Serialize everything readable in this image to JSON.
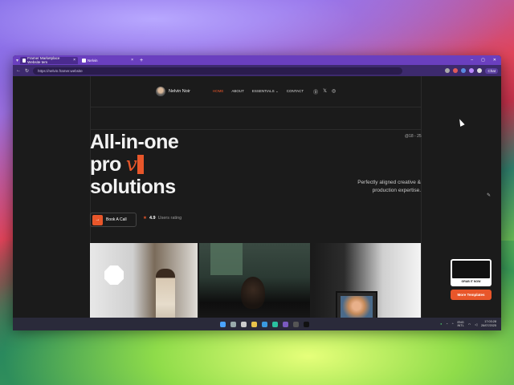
{
  "browser": {
    "tabs": [
      {
        "title": "Framer Marketplace Website tem",
        "active": true
      },
      {
        "title": "Nelvin",
        "active": false
      }
    ],
    "url": "https://nelvin.framer.website",
    "chat_label": "Chat"
  },
  "nav": {
    "brand": "Nelvin Noir",
    "menu": [
      "HOME",
      "ABOUT",
      "ESSENTIALS",
      "CONTACT"
    ],
    "essentials_chevron": "⌄",
    "social": [
      "⓪",
      "𝕏",
      "◎"
    ]
  },
  "hero": {
    "line1": "All-in-one",
    "line2": "pro",
    "typed": "v",
    "line3": "solutions",
    "date_tag": "@18 - 25",
    "subtitle_1": "Perfectly aligned creative &",
    "subtitle_2": "production expertise."
  },
  "cta": {
    "arrow": "→",
    "label": "Book A Call",
    "rating_value": "4.9",
    "rating_text": "Users rating"
  },
  "promo": {
    "grab_label": "GRAB IT NOW",
    "more_label": "More Templates"
  },
  "taskbar": {
    "lang_1": "ENG",
    "lang_2": "INTL",
    "time": "17:03:28",
    "date": "26/07/2025"
  },
  "colors": {
    "accent": "#e8562a",
    "page_bg": "#1b1b1b",
    "tabbar": "#6a3fbf"
  }
}
